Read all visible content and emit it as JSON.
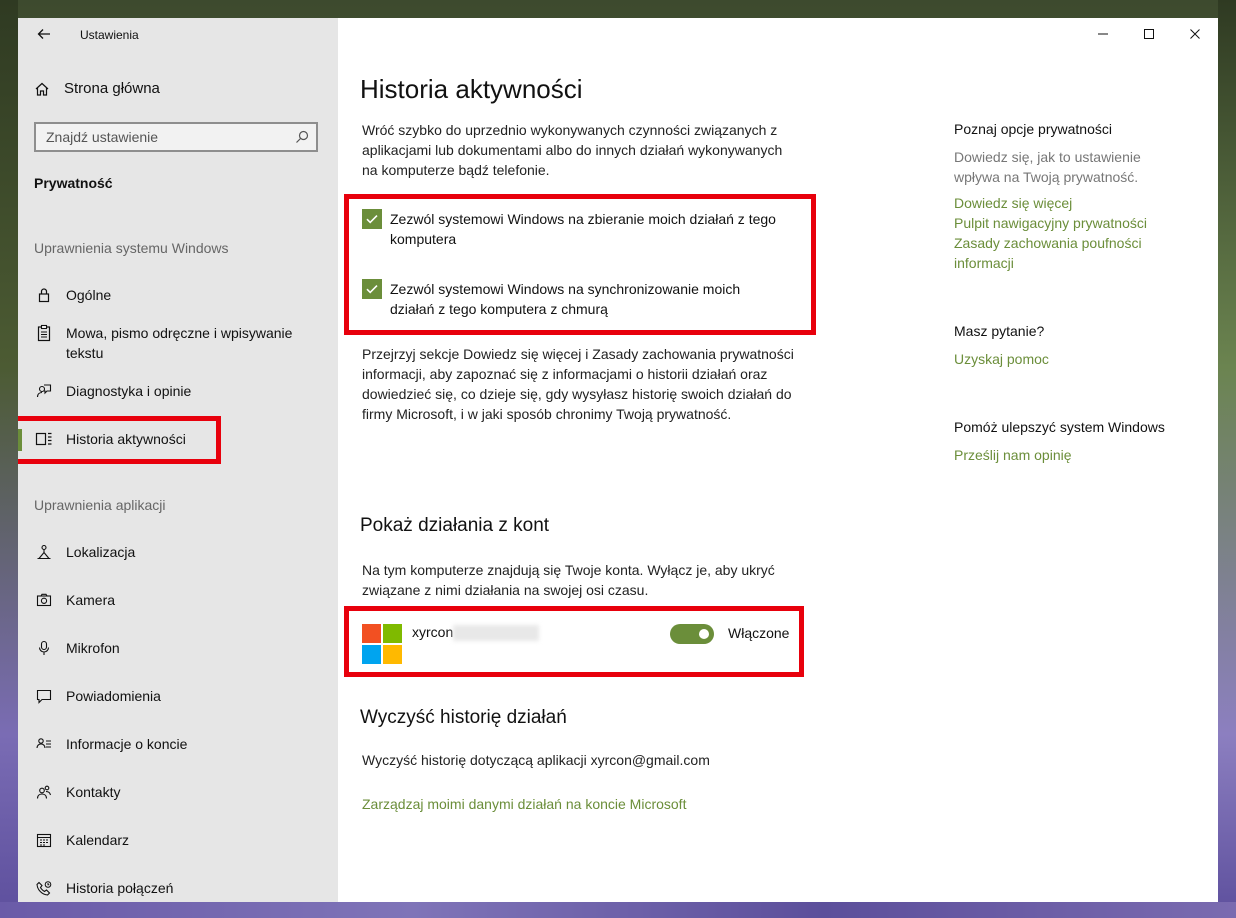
{
  "window": {
    "title": "Ustawienia",
    "back_icon": "back-arrow-icon",
    "controls": {
      "minimize": "—",
      "maximize": "☐",
      "close": "✕"
    }
  },
  "sidebar": {
    "home_label": "Strona główna",
    "search_placeholder": "Znajdź ustawienie",
    "section_title": "Prywatność",
    "group_windows": "Uprawnienia systemu Windows",
    "group_apps": "Uprawnienia aplikacji",
    "windows_items": [
      {
        "label": "Ogólne",
        "icon": "lock-icon"
      },
      {
        "label": "Mowa, pismo odręczne i wpisywanie tekstu",
        "icon": "clipboard-icon"
      },
      {
        "label": "Diagnostyka i opinie",
        "icon": "feedback-icon"
      },
      {
        "label": "Historia aktywności",
        "icon": "timeline-icon",
        "active": true
      }
    ],
    "app_items": [
      {
        "label": "Lokalizacja",
        "icon": "location-icon"
      },
      {
        "label": "Kamera",
        "icon": "camera-icon"
      },
      {
        "label": "Mikrofon",
        "icon": "microphone-icon"
      },
      {
        "label": "Powiadomienia",
        "icon": "notification-icon"
      },
      {
        "label": "Informacje o koncie",
        "icon": "account-info-icon"
      },
      {
        "label": "Kontakty",
        "icon": "contacts-icon"
      },
      {
        "label": "Kalendarz",
        "icon": "calendar-icon"
      },
      {
        "label": "Historia połączeń",
        "icon": "call-history-icon"
      }
    ]
  },
  "main": {
    "title": "Historia aktywności",
    "intro": "Wróć szybko do uprzednio wykonywanych czynności związanych z aplikacjami lub dokumentami albo do innych działań wykonywanych na komputerze bądź telefonie.",
    "checkbox_collect": {
      "label": "Zezwól systemowi Windows na zbieranie moich działań z tego komputera",
      "checked": true
    },
    "checkbox_sync": {
      "label": "Zezwól systemowi Windows na synchronizowanie moich działań z tego komputera z chmurą",
      "checked": true
    },
    "privacy_text": "Przejrzyj sekcje Dowiedz się więcej i Zasady zachowania prywatności informacji, aby zapoznać się z informacjami o historii działań oraz dowiedzieć się, co dzieje się, gdy wysyłasz historię swoich działań do firmy Microsoft, i w jaki sposób chronimy Twoją prywatność.",
    "accounts_heading": "Pokaż działania z kont",
    "accounts_text": "Na tym komputerze znajdują się Twoje konta. Wyłącz je, aby ukryć związane z nimi działania na swojej osi czasu.",
    "account": {
      "name": "xyrcon",
      "toggle_state": "Włączone",
      "toggle_on": true
    },
    "clear_heading": "Wyczyść historię działań",
    "clear_text": "Wyczyść historię dotyczącą aplikacji xyrcon@gmail.com",
    "manage_link": "Zarządzaj moimi danymi działań na koncie Microsoft"
  },
  "right_panel": {
    "privacy_heading": "Poznaj opcje prywatności",
    "privacy_text": "Dowiedz się, jak to ustawienie wpływa na Twoją prywatność.",
    "links": [
      "Dowiedz się więcej",
      "Pulpit nawigacyjny prywatności",
      "Zasady zachowania poufności informacji"
    ],
    "question_heading": "Masz pytanie?",
    "help_link": "Uzyskaj pomoc",
    "improve_heading": "Pomóż ulepszyć system Windows",
    "feedback_link": "Prześlij nam opinię"
  },
  "colors": {
    "accent": "#6b8e3a",
    "highlight": "#e8000c",
    "sidebar_bg": "#e6e6e6"
  }
}
